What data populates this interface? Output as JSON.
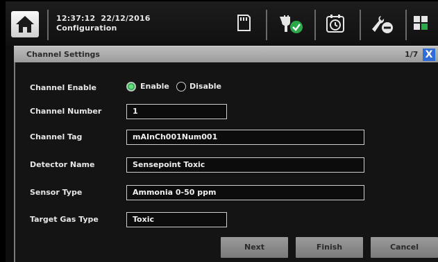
{
  "header": {
    "time": "12:37:12",
    "date": "22/12/2016",
    "subtitle": "Configuration"
  },
  "toolbar": {
    "icons": [
      "sd-card-icon",
      "power-plug-ok-icon",
      "alarm-clock-icon",
      "wrench-tool-icon",
      "grid-settings-icon"
    ]
  },
  "panel": {
    "title": "Channel Settings",
    "page": "1/7",
    "close_label": "X"
  },
  "form": {
    "channel_enable": {
      "label": "Channel Enable",
      "options": [
        "Enable",
        "Disable"
      ],
      "selected": "Enable"
    },
    "channel_number": {
      "label": "Channel Number",
      "value": "1"
    },
    "channel_tag": {
      "label": "Channel Tag",
      "value": "mAInCh001Num001"
    },
    "detector_name": {
      "label": "Detector Name",
      "value": "Sensepoint Toxic"
    },
    "sensor_type": {
      "label": "Sensor Type",
      "value": "Ammonia 0-50 ppm"
    },
    "target_gas_type": {
      "label": "Target Gas Type",
      "value": "Toxic"
    }
  },
  "buttons": {
    "next": "Next",
    "finish": "Finish",
    "cancel": "Cancel"
  },
  "colors": {
    "accent_blue": "#2f6cd4",
    "ok_green": "#1a8f3a",
    "panel_header": "#a9a9a9"
  }
}
